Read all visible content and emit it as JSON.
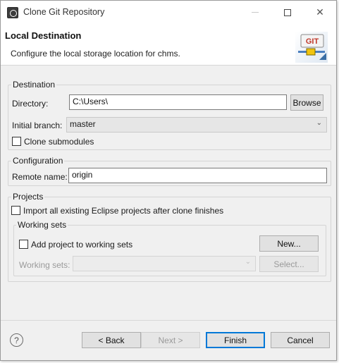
{
  "window": {
    "title": "Clone Git Repository",
    "minimize_icon": "minimize-icon",
    "maximize_icon": "maximize-icon",
    "close_icon": "close-icon",
    "close_glyph": "✕"
  },
  "header": {
    "title": "Local Destination",
    "description": "Configure the local storage location for chms.",
    "logo_text": "GIT"
  },
  "destination": {
    "legend": "Destination",
    "directory_label": "Directory:",
    "directory_value": "C:\\Users\\",
    "browse_label": "Browse",
    "initial_branch_label": "Initial branch:",
    "initial_branch_value": "master",
    "clone_submodules_label": "Clone submodules",
    "clone_submodules_checked": false
  },
  "configuration": {
    "legend": "Configuration",
    "remote_name_label": "Remote name:",
    "remote_name_value": "origin"
  },
  "projects": {
    "legend": "Projects",
    "import_label": "Import all existing Eclipse projects after clone finishes",
    "import_checked": false,
    "working_sets": {
      "legend": "Working sets",
      "add_label": "Add project to working sets",
      "add_checked": false,
      "new_label": "New...",
      "working_sets_label": "Working sets:",
      "working_sets_value": "",
      "select_label": "Select..."
    }
  },
  "footer": {
    "help_glyph": "?",
    "back_label": "< Back",
    "next_label": "Next >",
    "finish_label": "Finish",
    "cancel_label": "Cancel"
  },
  "colors": {
    "accent": "#0078d7",
    "window_bg": "#f0f0f0",
    "banner_bg": "#ffffff"
  }
}
